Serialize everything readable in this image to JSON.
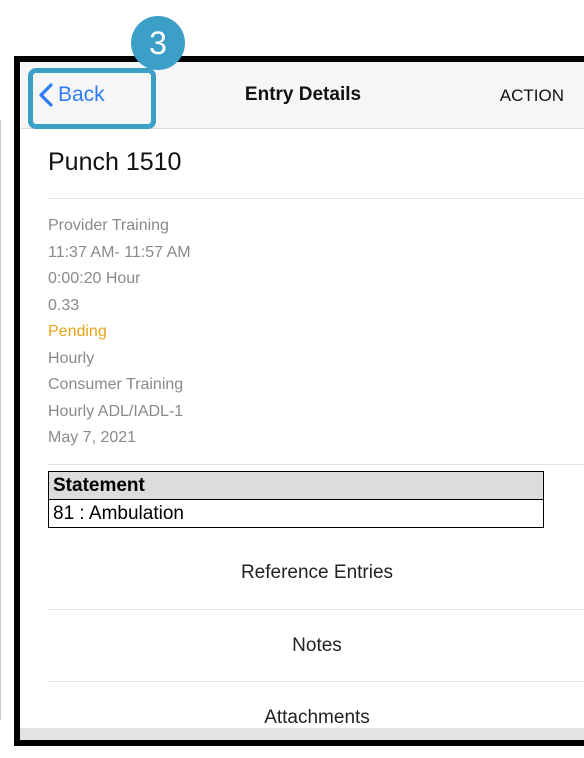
{
  "tutorial": {
    "step_number": "3",
    "highlight_color": "#3c9fc8"
  },
  "navbar": {
    "back_label": "Back",
    "back_icon": "chevron-left-icon",
    "title": "Entry Details",
    "action_label": "ACTION",
    "accent_color": "#2f7cf6"
  },
  "entry": {
    "title": "Punch 1510",
    "details": [
      "Provider Training",
      "11:37 AM- 11:57 AM",
      "0:00:20 Hour",
      "0.33",
      "Pending",
      "Hourly",
      "Consumer Training",
      "Hourly ADL/IADL-1",
      "May 7, 2021"
    ],
    "status_color": "#e8a317"
  },
  "statement": {
    "header": "Statement",
    "rows": [
      "81 : Ambulation"
    ]
  },
  "menu": {
    "items": [
      "Reference Entries",
      "Notes",
      "Attachments"
    ]
  }
}
